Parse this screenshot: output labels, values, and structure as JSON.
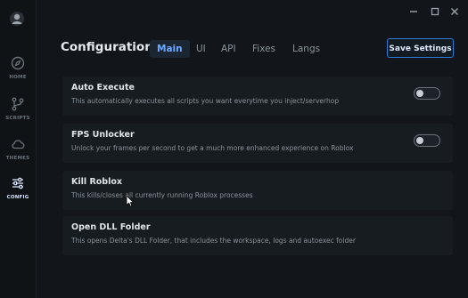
{
  "sidebar": {
    "items": [
      {
        "label": "HOME",
        "icon": "compass-icon",
        "active": false
      },
      {
        "label": "SCRIPTS",
        "icon": "branch-icon",
        "active": false
      },
      {
        "label": "THEMES",
        "icon": "cloud-icon",
        "active": false
      },
      {
        "label": "CONFIG",
        "icon": "sliders-icon",
        "active": true
      }
    ]
  },
  "header": {
    "title": "Configuration",
    "tabs": [
      {
        "label": "Main",
        "active": true
      },
      {
        "label": "UI",
        "active": false
      },
      {
        "label": "API",
        "active": false
      },
      {
        "label": "Fixes",
        "active": false
      },
      {
        "label": "Langs",
        "active": false
      }
    ],
    "save_label": "Save Settings"
  },
  "settings": [
    {
      "title": "Auto Execute",
      "description": "This automatically executes all scripts you want everytime you inject/serverhop",
      "toggle": false
    },
    {
      "title": "FPS Unlocker",
      "description": "Unlock your frames per second to get a much more enhanced experience on Roblox",
      "toggle": false
    },
    {
      "title": "Kill Roblox",
      "description": "This kills/closes all currently running Roblox processes"
    },
    {
      "title": "Open DLL Folder",
      "description": "This opens Delta's DLL Folder, that includes the workspace, logs and autoexec folder"
    }
  ],
  "colors": {
    "accent": "#2f7bd8",
    "background": "#12161a",
    "card": "#171c20"
  }
}
